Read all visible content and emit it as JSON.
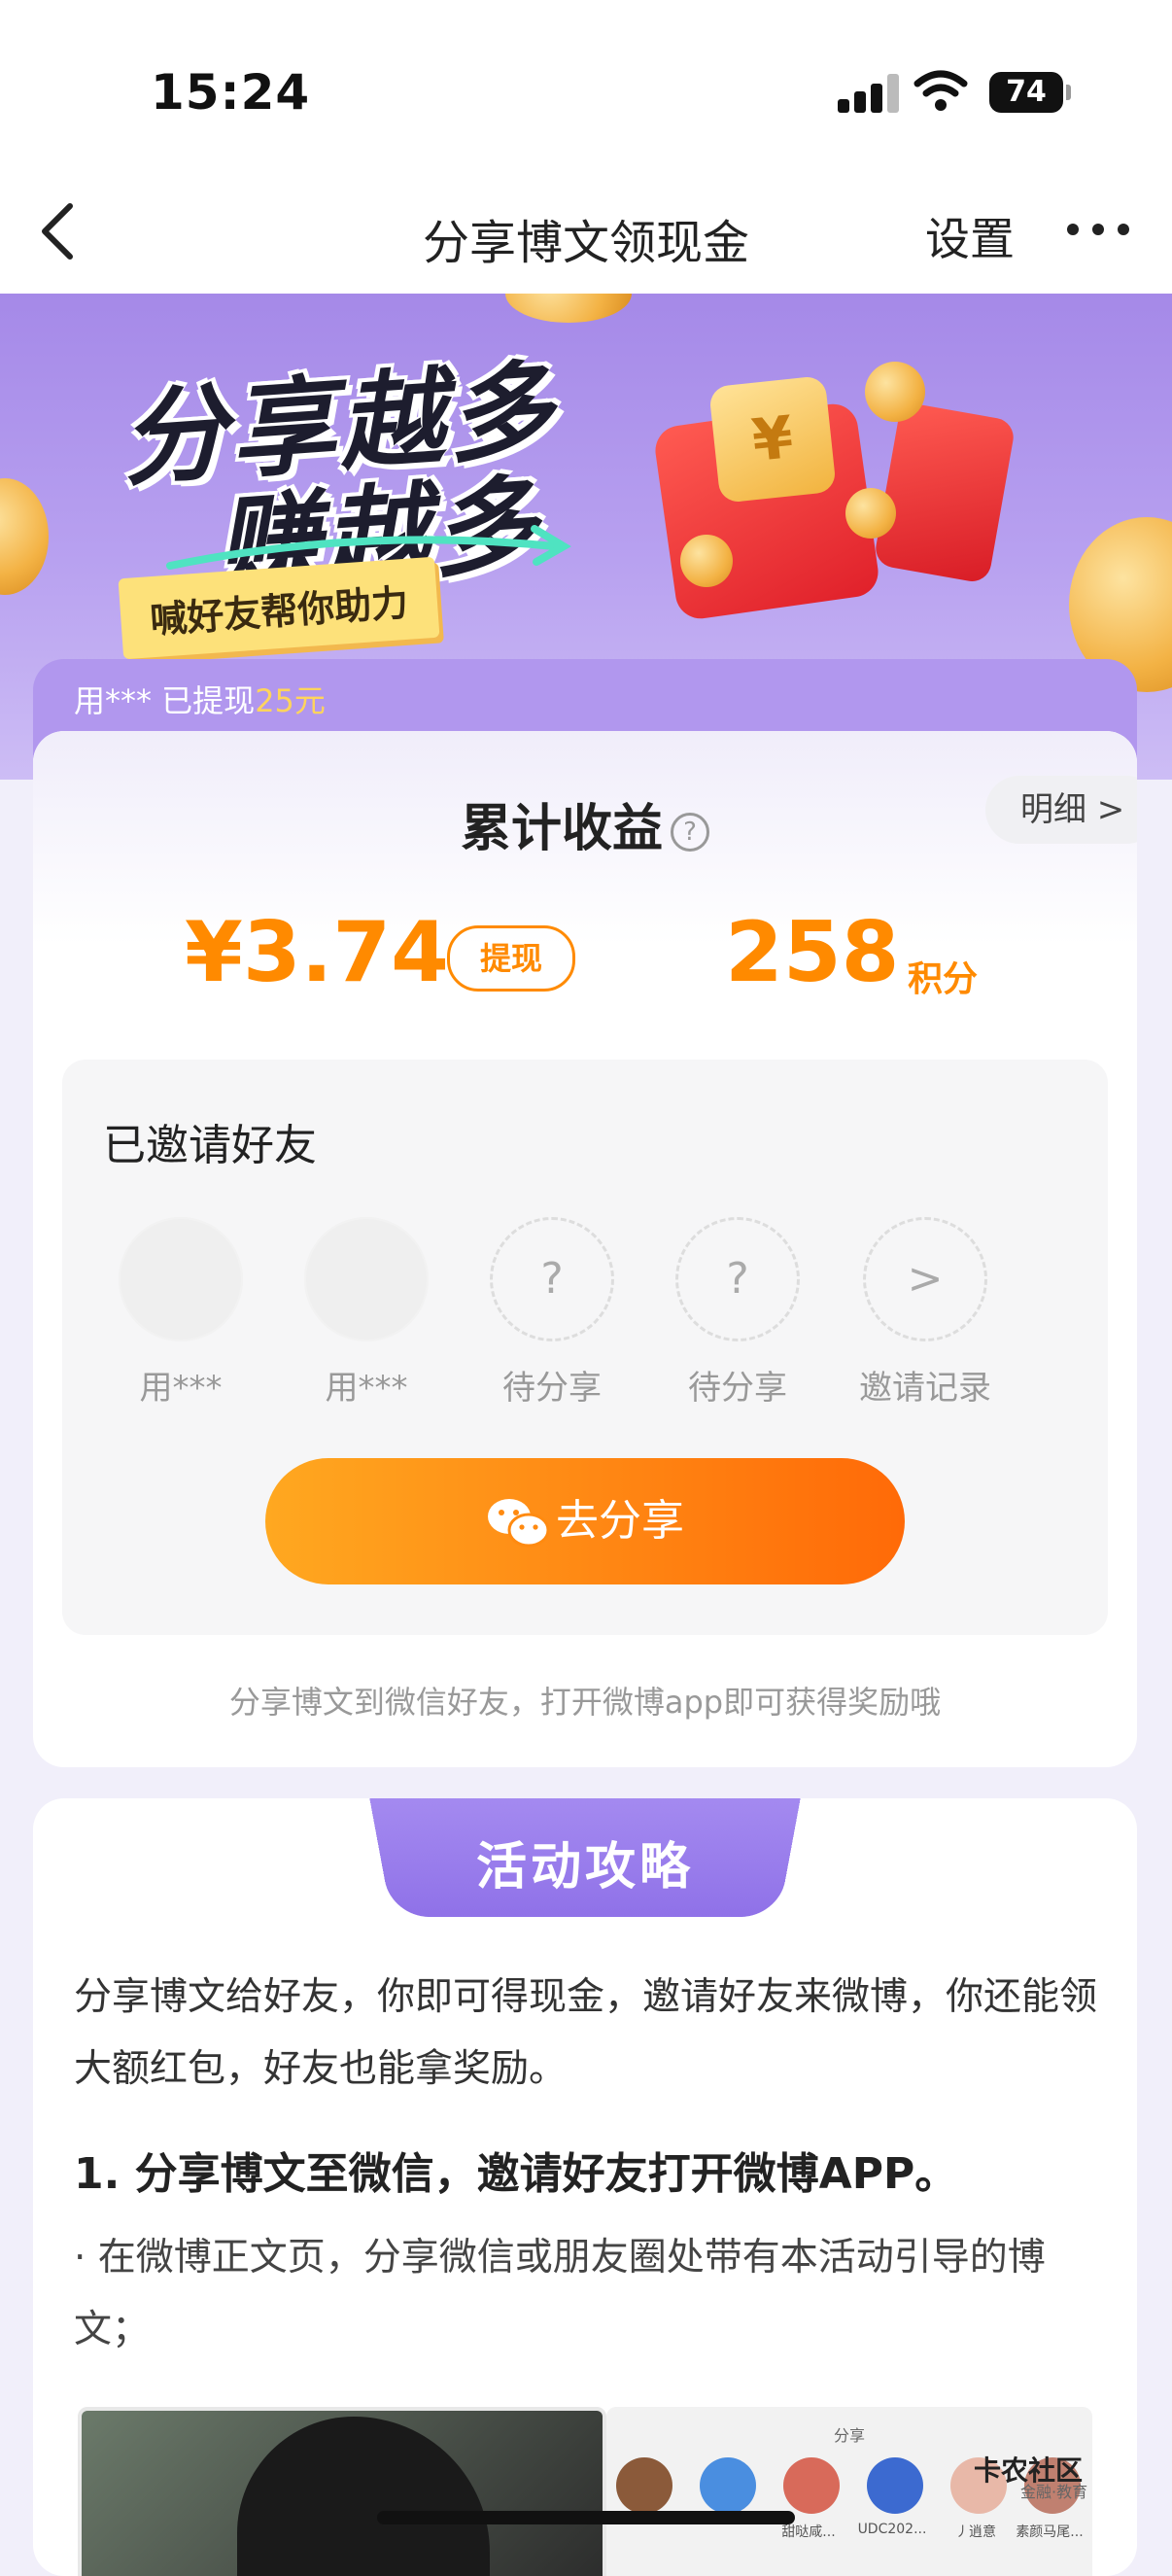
{
  "status": {
    "time": "15:24",
    "battery": "74"
  },
  "nav": {
    "title": "分享博文领现金",
    "settings": "设置"
  },
  "banner": {
    "line1": "分享越多",
    "line2": "赚越多",
    "tag": "喊好友帮你助力"
  },
  "ticker": {
    "text": "用*** 已提现",
    "amount": "25元"
  },
  "earnings": {
    "title": "累计收益",
    "detail": "明细 >",
    "money": "¥3.74",
    "withdraw": "提现",
    "points": "258",
    "points_unit": "积分"
  },
  "invite": {
    "title": "已邀请好友",
    "slots": [
      {
        "label": "用***",
        "kind": "friend"
      },
      {
        "label": "用***",
        "kind": "friend"
      },
      {
        "label": "待分享",
        "kind": "pending",
        "mark": "?"
      },
      {
        "label": "待分享",
        "kind": "pending",
        "mark": "?"
      },
      {
        "label": "邀请记录",
        "kind": "record",
        "mark": ">"
      }
    ],
    "share_button": "去分享",
    "hint": "分享博文到微信好友，打开微博app即可获得奖励哦"
  },
  "rules": {
    "tab": "活动攻略",
    "intro": "分享博文给好友，你即可得现金，邀请好友来微博，你还能领大额红包，好友也能拿奖励。",
    "step1_title": "1. 分享博文至微信，邀请好友打开微博APP。",
    "step1_desc": "· 在微博正文页，分享微信或朋友圈处带有本活动引导的博文；",
    "screenshot_title": "分享",
    "screenshot_labels": [
      "",
      "",
      "甜哒咸...",
      "UDC202...",
      "丿逍意",
      "素颜马尾..."
    ]
  },
  "watermark": {
    "title": "卡农社区",
    "sub": "金融·教育"
  },
  "colors": {
    "accent": "#ff8a00",
    "purple": "#a589e8",
    "wechat_btn": "#ff6a08"
  }
}
